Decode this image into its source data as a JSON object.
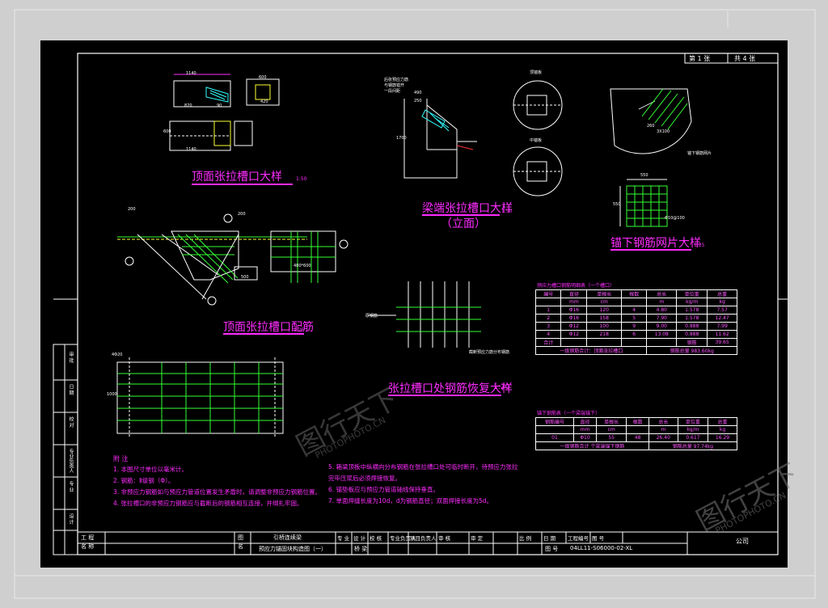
{
  "sheet": {
    "label_sheet": "第 1 张",
    "label_total": "共 4 张"
  },
  "titles": {
    "t1": "顶面张拉槽口大样",
    "t2": "梁端张拉槽口大样",
    "t2b": "（立面）",
    "t3": "锚下钢筋网片大样",
    "t4": "顶面张拉槽口配筋",
    "t5": "张拉槽口处钢筋恢复大样",
    "scale_t4": "1:25",
    "scale_t5": "1:20",
    "scale_t1": "1:50",
    "scale_t2": "1:50",
    "scale_t3": "1:25"
  },
  "dims": {
    "d1140a": "1140",
    "d870": "870",
    "d90": "90",
    "d600a": "600",
    "d400": "400",
    "d420": "420",
    "d60": "60",
    "d1140b": "1140",
    "d600b": "600",
    "d490": "490",
    "d250": "250",
    "d1700": "1700",
    "d550a": "550",
    "d550b": "550",
    "d480": "480*600",
    "d500": "500",
    "d1000": "1000",
    "d420b": "4Φ20",
    "d200a": "200",
    "d200b": "200",
    "d260": "260",
    "d250b": "250",
    "d3x100": "3X100",
    "d010": "Φ10@100"
  },
  "labels": {
    "l_front": "后张预应力筋",
    "l_front2": "与钢筋错开",
    "l_front3": "一段间距",
    "l_mid1": "顶锚板",
    "l_mid2": "中锚板",
    "l_mesh": "锚下钢筋网片",
    "l_rebar": "原钢筋",
    "l_anchor": "截断预应力筋分布钢筋"
  },
  "table1": {
    "caption": "预应力槽口钢筋明细表（一个槽口）",
    "headers": [
      "编号",
      "直径",
      "单根长",
      "根数",
      "总长",
      "单位重",
      "总重"
    ],
    "units": [
      "",
      "mm",
      "cm",
      "",
      "m",
      "kg/m",
      "kg"
    ],
    "rows": [
      [
        "1",
        "Φ16",
        "120",
        "4",
        "4.80",
        "1.578",
        "7.57"
      ],
      [
        "2",
        "Φ16",
        "158",
        "5",
        "7.90",
        "1.578",
        "12.47"
      ],
      [
        "3",
        "Φ12",
        "100",
        "9",
        "9.00",
        "0.888",
        "7.99"
      ],
      [
        "4",
        "Φ12",
        "218",
        "6",
        "13.08",
        "0.888",
        "11.62"
      ]
    ],
    "total_label": "合计",
    "total_unit": "钢筋",
    "total_value": "39.65",
    "footer_left": "一级钢筋合计：顶面张拉槽口",
    "footer_right": "钢筋总量 983.60kg"
  },
  "table2": {
    "caption": "锚下钢筋表（一个梁端锚下）",
    "headers": [
      "钢筋编号",
      "直径",
      "单根长",
      "根数",
      "总长",
      "单位重",
      "总重"
    ],
    "units": [
      "",
      "mm",
      "cm",
      "",
      "m",
      "kg/m",
      "kg"
    ],
    "rows": [
      [
        "01",
        "Φ10",
        "55",
        "48",
        "26.40",
        "0.617",
        "16.29"
      ]
    ],
    "footer_left": "一级钢筋合计  个梁端锚下钢筋",
    "footer_right": "钢筋总量 97.74kg"
  },
  "notes": {
    "heading": "附 注",
    "n1": "1. 本图尺寸单位以毫米计。",
    "n2": "2. 钢筋：Ⅱ级钢（Φ）。",
    "n3": "3. 非预应力钢筋如与预应力管道位置发生矛盾时，请调整非预应力钢筋位置。",
    "n4": "4. 张拉槽口的非预应力钢筋应与截断后的钢筋相互连接，并绑扎牢固。",
    "n5": "5. 箱梁顶板中纵横向分布钢筋在张拉槽口处可临时断开，待预应力张拉",
    "n5b": "   完毕压浆后必须焊接恢复。",
    "n6": "6. 锚垫板应与预应力管道轴线保持垂直。",
    "n7": "7. 单面焊缝长度为10d，d为钢筋直径；双面焊接长度为5d。"
  },
  "titleblock": {
    "proj_label": "工 程\n名 称",
    "drawing_label": "图\n名",
    "drawing_name1": "引桥连续梁",
    "drawing_name2": "预应力锚固块构造图（一）",
    "cols": [
      "专 业",
      "设 计",
      "校 核",
      "专业负责人",
      "项目负责人",
      "审 核",
      "审 定",
      "比 例",
      "日 期",
      "工程编号",
      "图 号"
    ],
    "row2": [
      "桥 梁",
      "",
      "",
      "",
      "",
      "",
      "",
      "",
      "图 号"
    ],
    "drawing_no": "04LL11-S06000-02-XL",
    "company": "公司",
    "side": [
      "审 批",
      "日 期",
      "校 对",
      "专业负责人",
      "专 业",
      "设 计"
    ]
  },
  "watermark": {
    "text1": "图行天下",
    "text2": "PHOTOPHOTO.CN"
  }
}
